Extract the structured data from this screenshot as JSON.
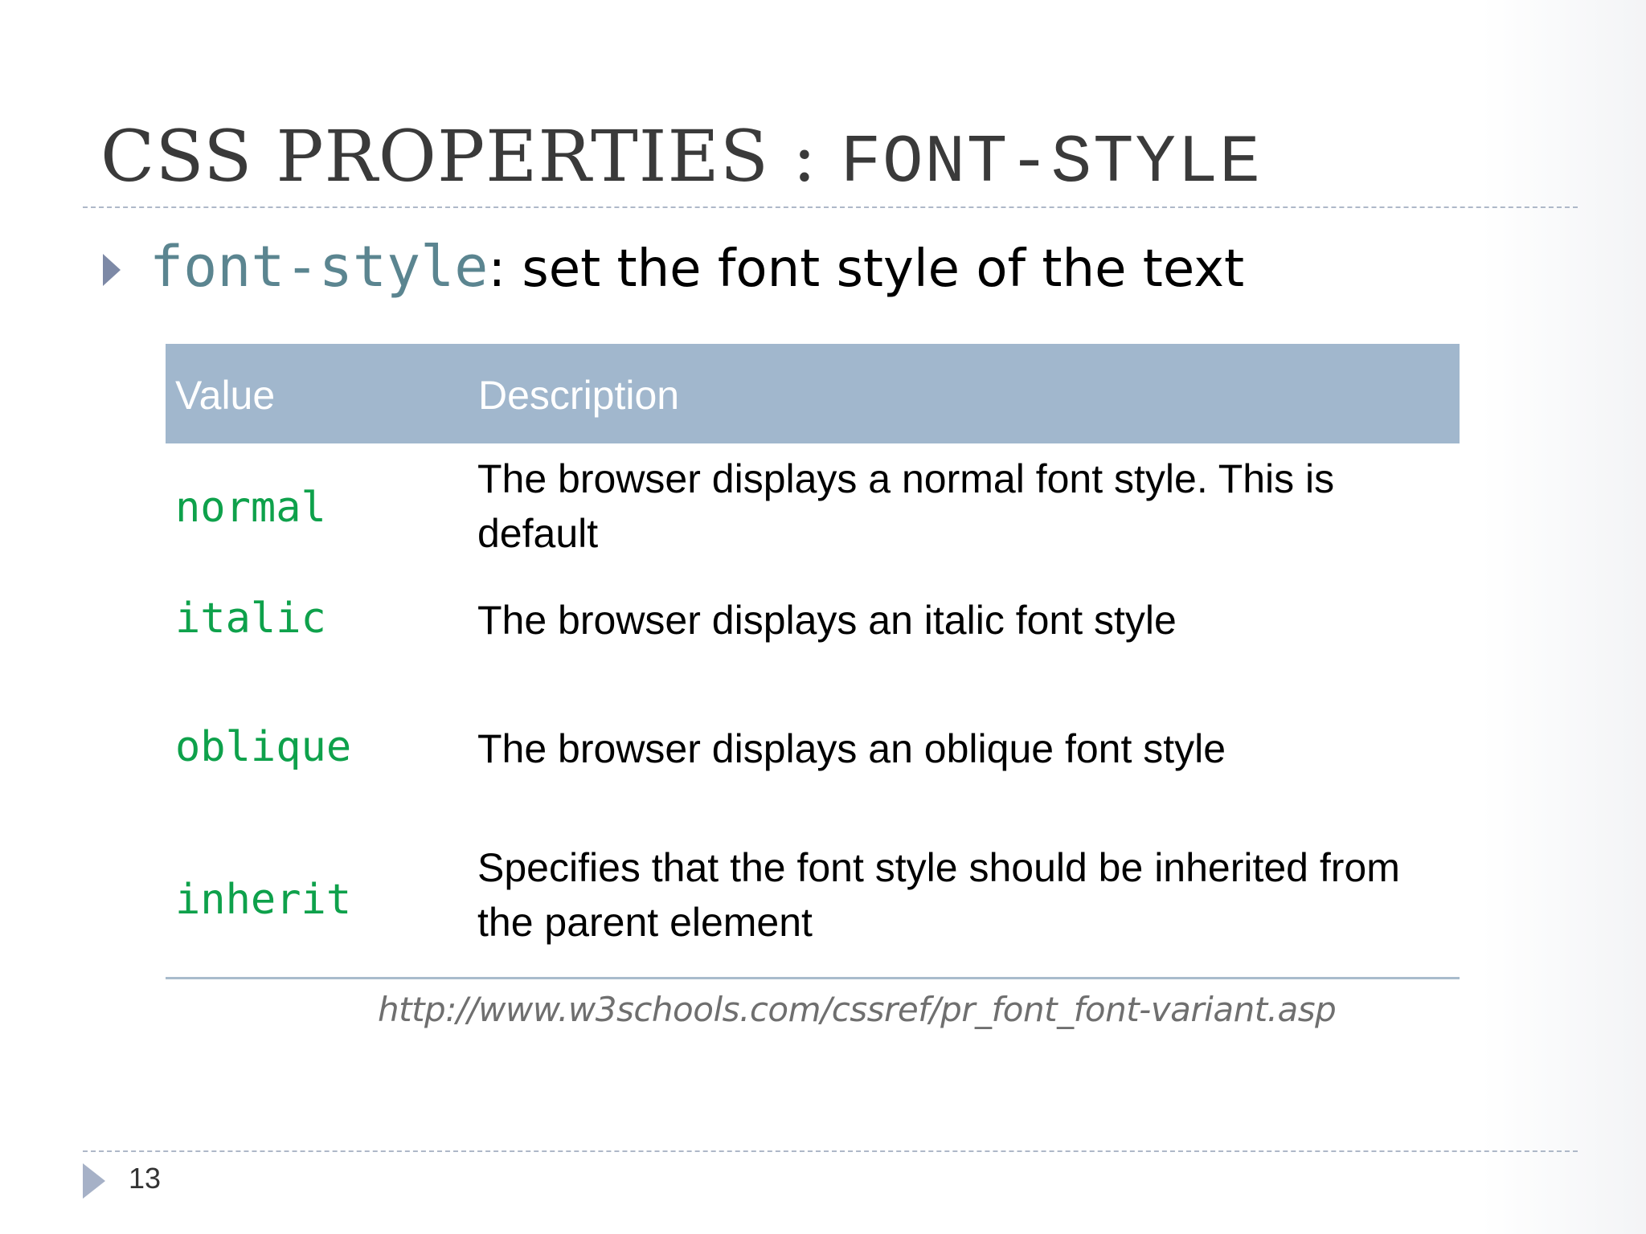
{
  "slide": {
    "title_main": "CSS PROPERTIES : ",
    "title_code": "FONT-STYLE",
    "bullet": {
      "code": "font-style",
      "text": ": set the font style of the text"
    },
    "table": {
      "headers": [
        "Value",
        "Description"
      ],
      "rows": [
        {
          "value": "normal",
          "description": "The browser displays a normal font style. This is default"
        },
        {
          "value": "italic",
          "description": "The browser displays an italic font style"
        },
        {
          "value": "oblique",
          "description": "The browser displays an oblique font style"
        },
        {
          "value": "inherit",
          "description": "Specifies that the font style should be inherited from the parent element"
        }
      ]
    },
    "source_url": "http://www.w3schools.com/cssref/pr_font_font-variant.asp",
    "page_number": "13"
  },
  "colors": {
    "title": "#3a3a3a",
    "header_bg": "#a1b7cd",
    "value_code": "#0ea14b",
    "bullet_code": "#5b8590",
    "source_text": "#6f6f6f"
  }
}
